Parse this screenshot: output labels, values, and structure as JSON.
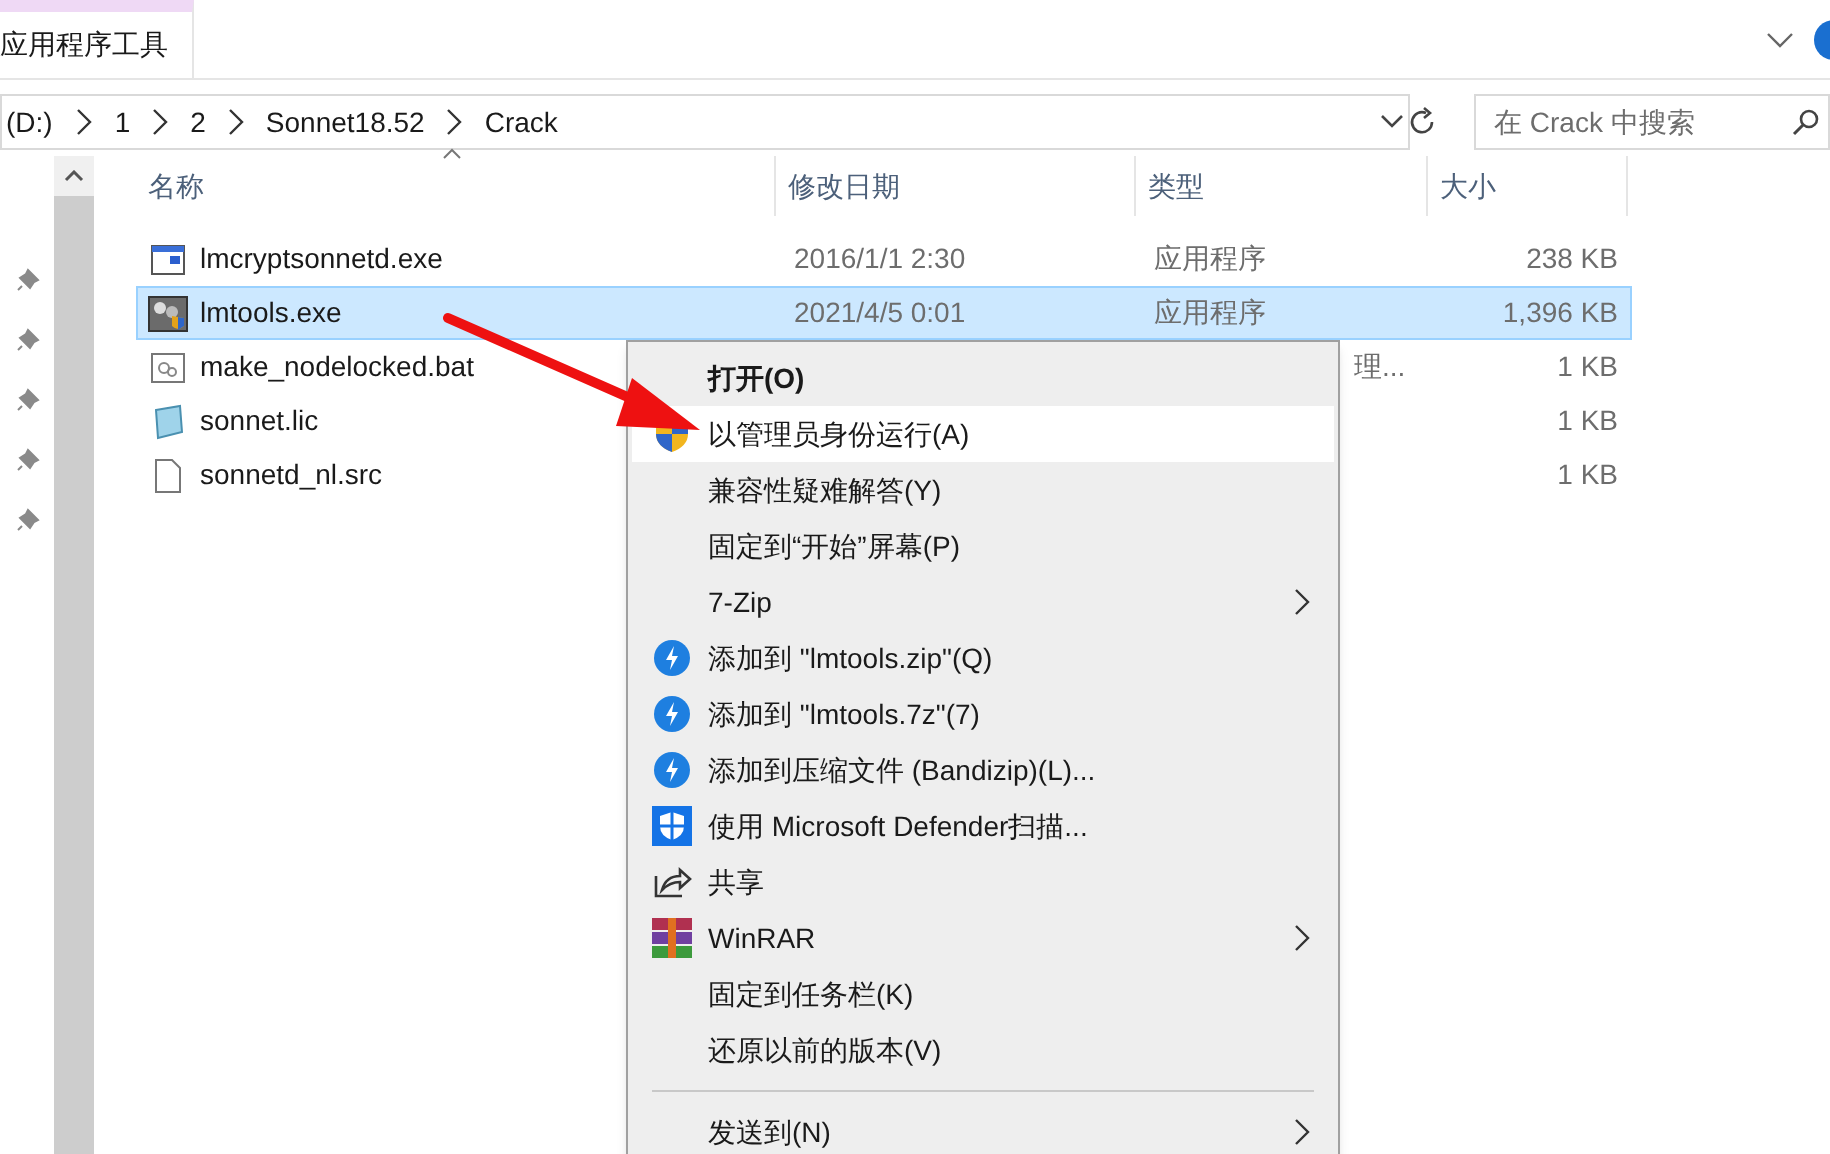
{
  "ribbon": {
    "tab": "应用程序工具"
  },
  "address": {
    "crumbs": [
      "(D:)",
      "1",
      "2",
      "Sonnet18.52",
      "Crack"
    ]
  },
  "search": {
    "placeholder": "在 Crack 中搜索"
  },
  "columns": [
    "名称",
    "修改日期",
    "类型",
    "大小"
  ],
  "files": [
    {
      "kind": "app",
      "name": "lmcryptsonnetd.exe",
      "date": "2016/1/1 2:30",
      "type": "应用程序",
      "size": "238 KB",
      "selected": false
    },
    {
      "kind": "tool",
      "name": "lmtools.exe",
      "date": "2021/4/5 0:01",
      "type": "应用程序",
      "size": "1,396 KB",
      "selected": true
    },
    {
      "kind": "bat",
      "name": "make_nodelocked.bat",
      "type": "理...",
      "size": "1 KB",
      "selected": false
    },
    {
      "kind": "lic",
      "name": "sonnet.lic",
      "size": "1 KB",
      "selected": false
    },
    {
      "kind": "file",
      "name": "sonnetd_nl.src",
      "size": "1 KB",
      "selected": false
    }
  ],
  "menu": [
    {
      "kind": "plain",
      "label": "打开(O)",
      "bold": true,
      "selected": false,
      "submenu": false
    },
    {
      "kind": "shield",
      "label": "以管理员身份运行(A)",
      "bold": false,
      "selected": true,
      "submenu": false
    },
    {
      "kind": "plain",
      "label": "兼容性疑难解答(Y)",
      "bold": false,
      "selected": false,
      "submenu": false
    },
    {
      "kind": "plain",
      "label": "固定到“开始”屏幕(P)",
      "bold": false,
      "selected": false,
      "submenu": false
    },
    {
      "kind": "plain",
      "label": "7-Zip",
      "bold": false,
      "selected": false,
      "submenu": true
    },
    {
      "kind": "bandizip",
      "label": "添加到 \"lmtools.zip\"(Q)",
      "bold": false,
      "selected": false,
      "submenu": false
    },
    {
      "kind": "bandizip",
      "label": "添加到 \"lmtools.7z\"(7)",
      "bold": false,
      "selected": false,
      "submenu": false
    },
    {
      "kind": "bandizip",
      "label": "添加到压缩文件 (Bandizip)(L)...",
      "bold": false,
      "selected": false,
      "submenu": false
    },
    {
      "kind": "defender",
      "label": "使用 Microsoft Defender扫描...",
      "bold": false,
      "selected": false,
      "submenu": false
    },
    {
      "kind": "share",
      "label": "共享",
      "bold": false,
      "selected": false,
      "submenu": false
    },
    {
      "kind": "winrar",
      "label": "WinRAR",
      "bold": false,
      "selected": false,
      "submenu": true
    },
    {
      "kind": "plain",
      "label": "固定到任务栏(K)",
      "bold": false,
      "selected": false,
      "submenu": false
    },
    {
      "kind": "plain",
      "label": "还原以前的版本(V)",
      "bold": false,
      "selected": false,
      "submenu": false
    },
    {
      "kind": "separator"
    },
    {
      "kind": "plain",
      "label": "发送到(N)",
      "bold": false,
      "selected": false,
      "submenu": true
    }
  ]
}
